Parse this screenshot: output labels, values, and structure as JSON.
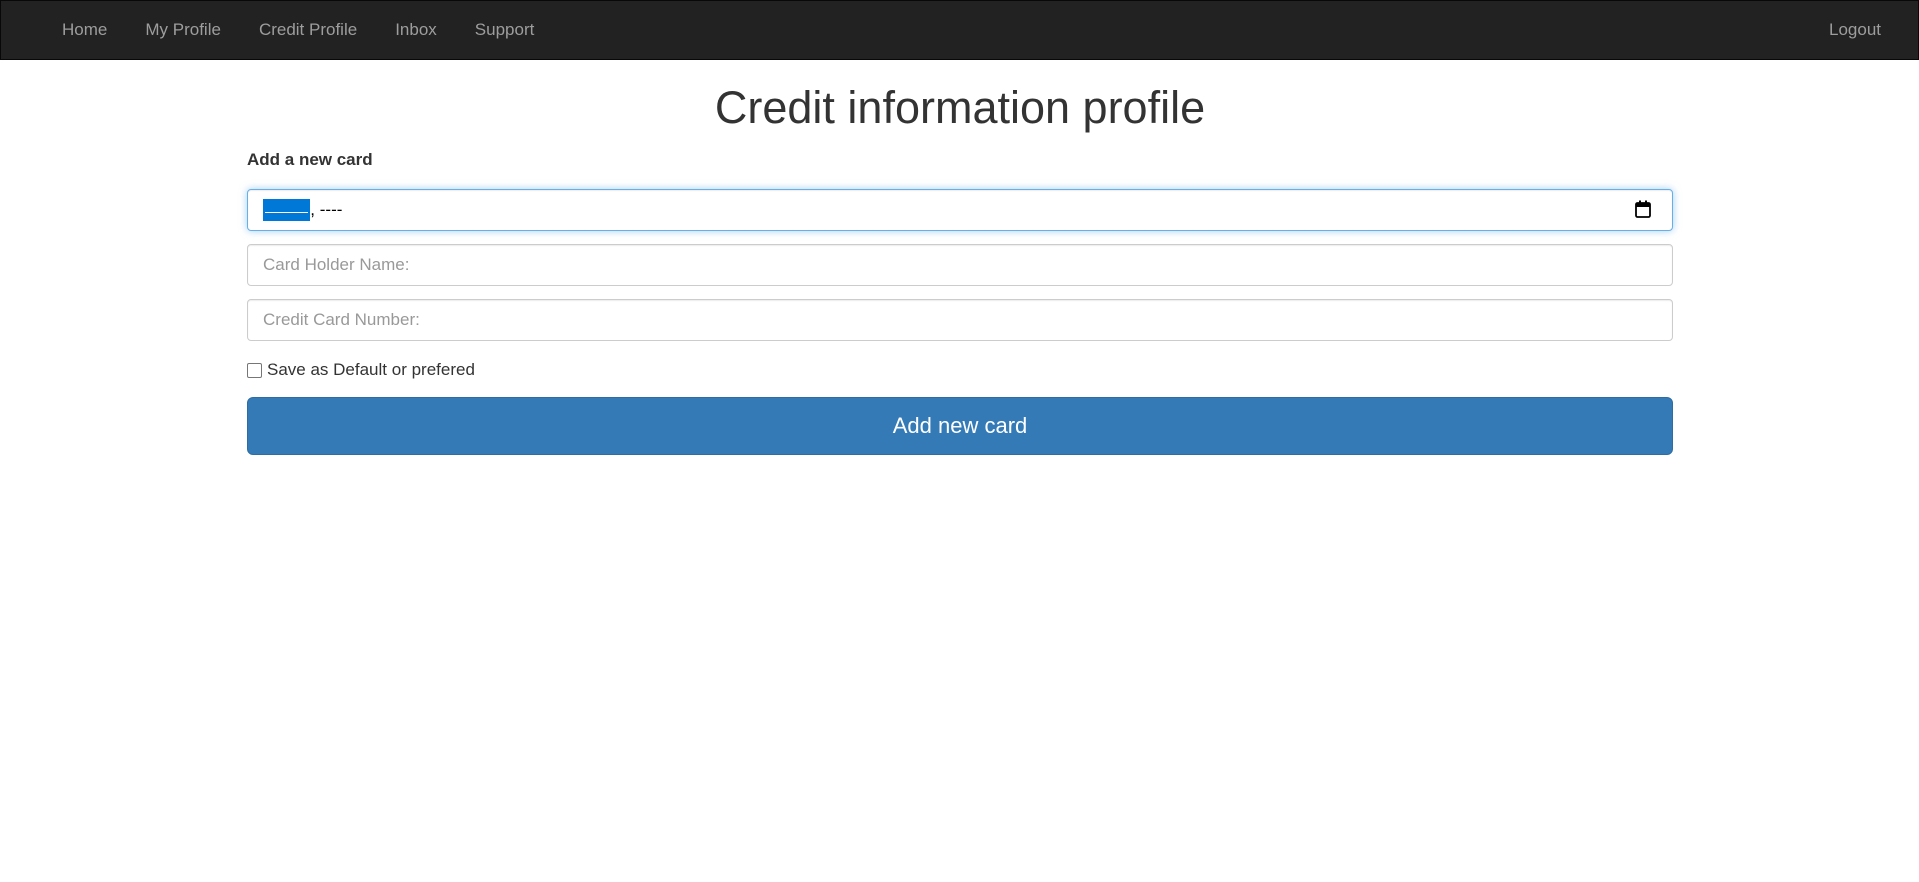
{
  "nav": {
    "items": [
      {
        "label": "Home"
      },
      {
        "label": "My Profile"
      },
      {
        "label": "Credit Profile"
      },
      {
        "label": "Inbox"
      },
      {
        "label": "Support"
      }
    ],
    "logout_label": "Logout"
  },
  "page": {
    "title": "Credit information profile",
    "section_title": "Add a new card"
  },
  "form": {
    "expiry_date": {
      "month_segment": "--------",
      "rest_segment": ", ----",
      "icon": "calendar-icon"
    },
    "holder_name": {
      "placeholder": "Card Holder Name:",
      "value": ""
    },
    "card_number": {
      "placeholder": "Credit Card Number:",
      "value": ""
    },
    "default_checkbox": {
      "label": "Save as Default or prefered",
      "checked": false
    },
    "submit_label": "Add new card"
  },
  "colors": {
    "navbar_bg": "#222222",
    "nav_link": "#9d9d9d",
    "primary": "#337ab7",
    "selection": "#0078d7",
    "focus_border": "#66afe9"
  }
}
